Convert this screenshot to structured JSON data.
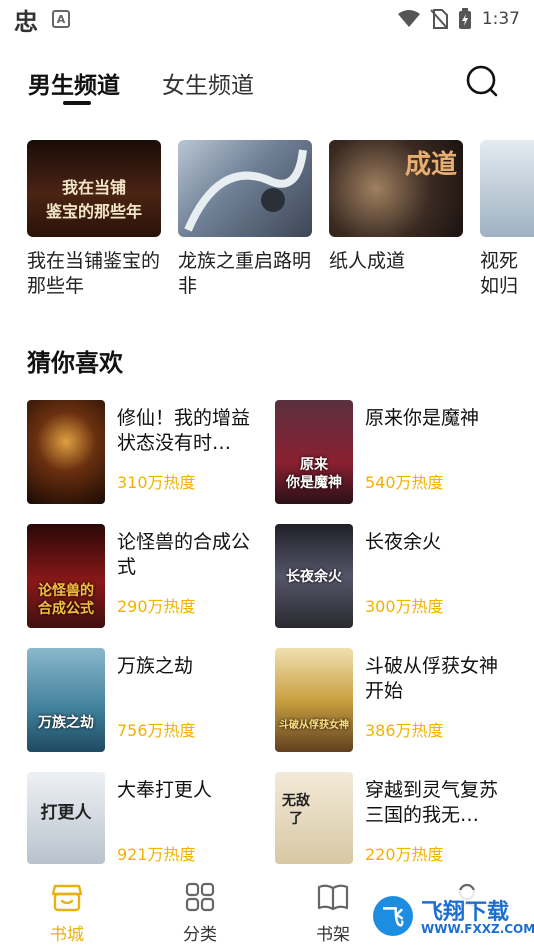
{
  "status_bar": {
    "app_logo": "忠",
    "notif_label": "A",
    "time": "1:37"
  },
  "header": {
    "tabs": [
      {
        "label": "男生频道",
        "active": true
      },
      {
        "label": "女生频道",
        "active": false
      }
    ],
    "search_icon": "search-icon"
  },
  "carousel": {
    "items": [
      {
        "title": "我在当铺鉴宝的那些年",
        "cover_text": "我在当铺\n鉴宝的那些年",
        "cover_color": "#3a1a10"
      },
      {
        "title": "龙族之重启路明非",
        "cover_text": "",
        "cover_color": "#5a6a80"
      },
      {
        "title": "纸人成道",
        "cover_text": "成道",
        "cover_color": "#3a2a22"
      },
      {
        "title": "视死如归子",
        "cover_text": "",
        "cover_color": "#c9d5e0"
      }
    ]
  },
  "section": {
    "title": "猜你喜欢"
  },
  "books": [
    {
      "title": "修仙！我的增益状态没有时…",
      "heat": "310万热度",
      "cover_color": "#2b1408",
      "cover_text": ""
    },
    {
      "title": "原来你是魔神",
      "heat": "540万热度",
      "cover_color": "#3a1a22",
      "cover_text": "原来\n你是魔神"
    },
    {
      "title": "论怪兽的合成公式",
      "heat": "290万热度",
      "cover_color": "#6a1010",
      "cover_text": "论怪兽的\n合成公式"
    },
    {
      "title": "长夜余火",
      "heat": "300万热度",
      "cover_color": "#3c3c44",
      "cover_text": "长夜余火"
    },
    {
      "title": "万族之劫",
      "heat": "756万热度",
      "cover_color": "#3f7f9a",
      "cover_text": "万族之劫"
    },
    {
      "title": "斗破从俘获女神开始",
      "heat": "386万热度",
      "cover_color": "#c9a040",
      "cover_text": "斗破从俘获女神"
    },
    {
      "title": "大奉打更人",
      "heat": "921万热度",
      "cover_color": "#d8dde2",
      "cover_text": "打更人"
    },
    {
      "title": "穿越到灵气复苏三国的我无…",
      "heat": "220万热度",
      "cover_color": "#e8dcc4",
      "cover_text": "无敌了"
    }
  ],
  "bottom_nav": {
    "items": [
      {
        "label": "书城",
        "icon": "bookstore-icon",
        "active": true
      },
      {
        "label": "分类",
        "icon": "grid-icon",
        "active": false
      },
      {
        "label": "书架",
        "icon": "bookshelf-icon",
        "active": false
      },
      {
        "label": "",
        "icon": "profile-icon",
        "active": false
      }
    ]
  },
  "watermark": {
    "title": "飞翔下载",
    "url": "WWW.FXXZ.COM"
  },
  "colors": {
    "accent": "#e8b10f",
    "heat": "#f2b200",
    "watermark": "#1c6fd0"
  }
}
